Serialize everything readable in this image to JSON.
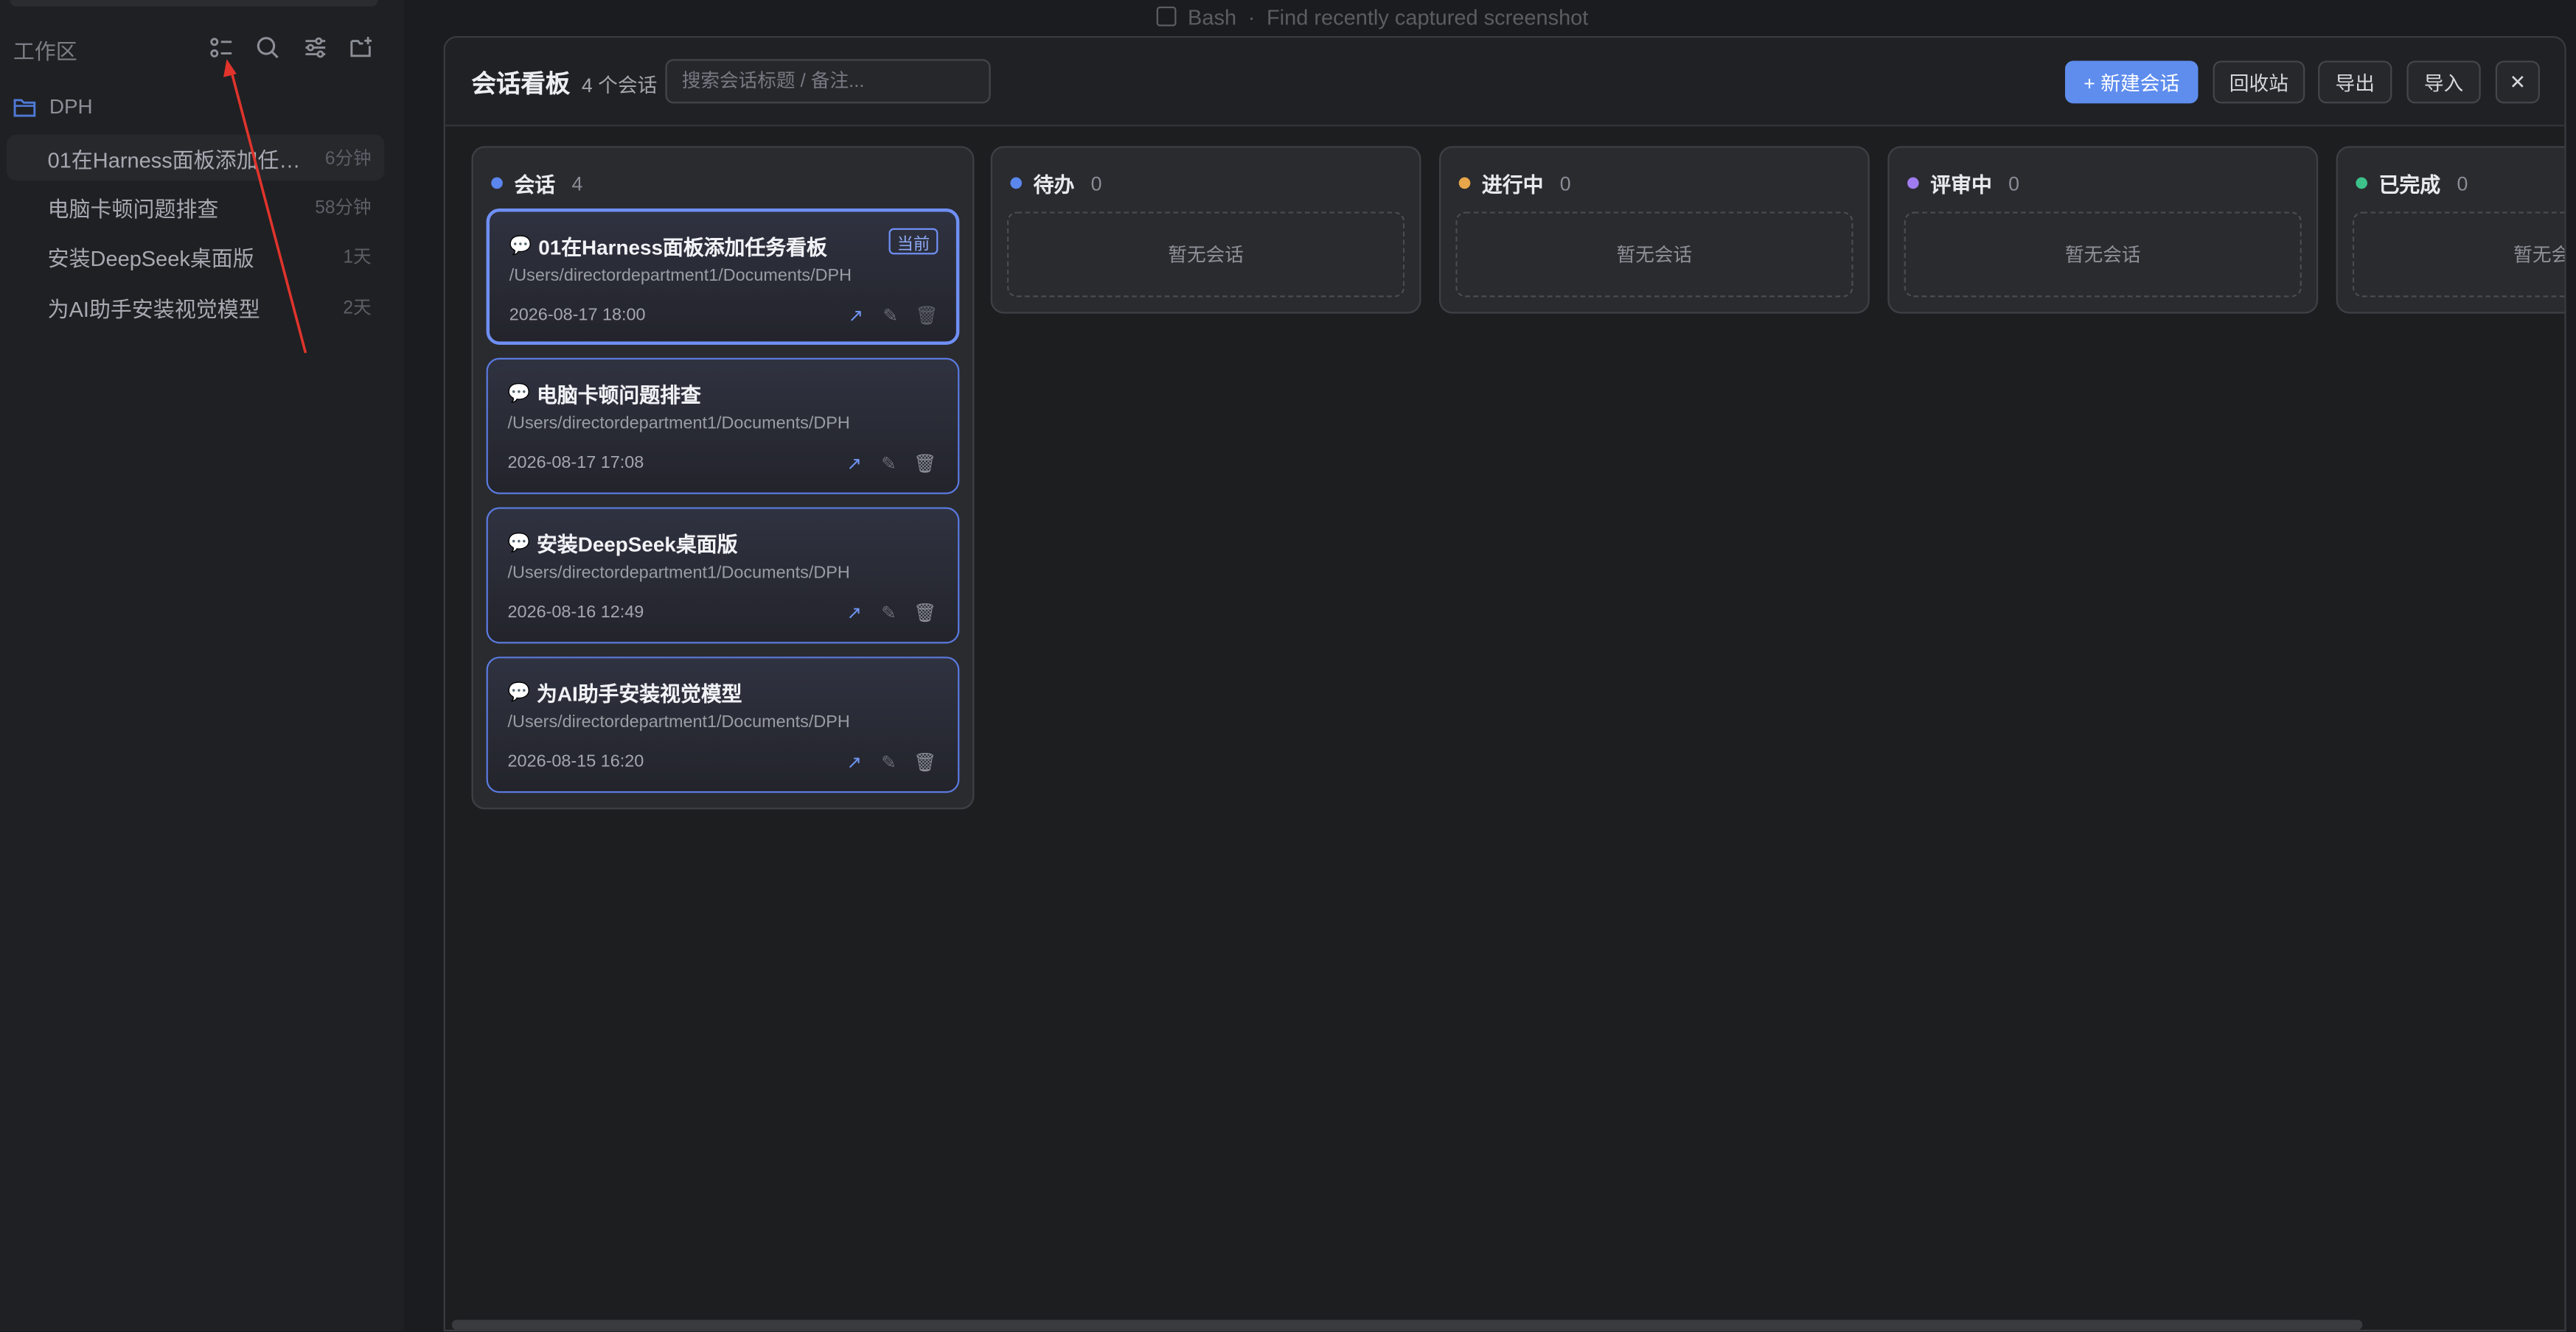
{
  "topbar": {
    "app": "Bash",
    "separator": "·",
    "task": "Find recently captured screenshot"
  },
  "sidebar": {
    "workspace_label": "工作区",
    "icons": [
      "list-view-icon",
      "search-icon",
      "settings-sliders-icon",
      "new-folder-icon"
    ],
    "folder": {
      "name": "DPH"
    },
    "sessions": [
      {
        "title": "01在Harness面板添加任务看板",
        "time": "6分钟"
      },
      {
        "title": "电脑卡顿问题排查",
        "time": "58分钟"
      },
      {
        "title": "安装DeepSeek桌面版",
        "time": "1天"
      },
      {
        "title": "为AI助手安装视觉模型",
        "time": "2天"
      }
    ]
  },
  "modal": {
    "title": "会话看板",
    "count": "4 个会话",
    "search_placeholder": "搜索会话标题 / 备注...",
    "buttons": {
      "new": "+ 新建会话",
      "recycle": "回收站",
      "export": "导出",
      "import": "导入",
      "close": "✕"
    }
  },
  "board": {
    "empty_text": "暂无会话",
    "columns": [
      {
        "name": "会话",
        "count": "4",
        "color": "#5b86ee"
      },
      {
        "name": "待办",
        "count": "0",
        "color": "#5b86ee"
      },
      {
        "name": "进行中",
        "count": "0",
        "color": "#e8a64a"
      },
      {
        "name": "评审中",
        "count": "0",
        "color": "#a07cf0"
      },
      {
        "name": "已完成",
        "count": "0",
        "color": "#3cc28a"
      }
    ],
    "cards": [
      {
        "title": "01在Harness面板添加任务看板",
        "path": "/Users/directordepartment1/Documents/DPH",
        "date": "2026-08-17 18:00",
        "badge": "当前"
      },
      {
        "title": "电脑卡顿问题排查",
        "path": "/Users/directordepartment1/Documents/DPH",
        "date": "2026-08-17 17:08"
      },
      {
        "title": "安装DeepSeek桌面版",
        "path": "/Users/directordepartment1/Documents/DPH",
        "date": "2026-08-16 12:49"
      },
      {
        "title": "为AI助手安装视觉模型",
        "path": "/Users/directordepartment1/Documents/DPH",
        "date": "2026-08-15 16:20"
      }
    ],
    "card_bubble": "💬",
    "card_actions": {
      "open": "↗",
      "edit": "✎",
      "delete": "🗑"
    }
  }
}
